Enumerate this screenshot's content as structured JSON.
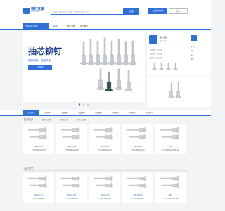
{
  "header": {
    "logo_title": "铆钉货源",
    "logo_sub": "liuhaib.com",
    "search_placeholder": "请输入要找的产品 例如：57铆钉 3.2*10 铝",
    "search_button": "搜索",
    "btn_primary": "免费发布供应",
    "btn_secondary": "登录"
  },
  "nav": {
    "all_categories": "全部商品分类 ▾",
    "items": [
      "首页",
      "快速下单",
      "关于我们"
    ]
  },
  "banner": {
    "headline": "抽芯铆钉",
    "subline": "国标规格，规格齐全",
    "button": "立即购买"
  },
  "shop_card": {
    "title": "铆钉货源",
    "tag": "生产厂家",
    "rows": [
      "营业执照：已认证",
      "实名认证：已认证",
      "企业认证：已认证"
    ]
  },
  "contact_card": {
    "rows": [
      "联 系 人：",
      "手机：",
      "电话：",
      "邮箱："
    ]
  },
  "category_tabs": [
    "开口铆钉",
    "封闭铆钉",
    "单鼓铆钉",
    "双鼓铆钉",
    "拉铆螺母",
    "环槽铆钉",
    "芯铆铆钉",
    "抽芯铆钉"
  ],
  "section1": {
    "title": "圆头开口型",
    "subtabs": [
      "圆头开口型",
      "大帽开口型",
      "沉头开口型"
    ],
    "products": [
      {
        "code": "GB12618.1",
        "name": "开口型平圆头抽芯铆钉"
      },
      {
        "code": "GB12618.2",
        "name": "开口型平圆头抽芯铆钉"
      },
      {
        "code": "GB12618.3",
        "name": "开口型平圆头抽芯铆钉"
      },
      {
        "code": "GB12618.4",
        "name": "开口型平圆头抽芯铆钉"
      },
      {
        "code": "BK1",
        "name": "开口型平圆头抽芯铆钉(铝)"
      }
    ]
  },
  "section2": {
    "title": "沉头开口型",
    "products": [
      {
        "code": "GB12617.1",
        "name": "开口型沉头抽芯铆钉"
      },
      {
        "code": "GB12617.2",
        "name": "开口型沉头抽芯铆钉"
      },
      {
        "code": "GB12617.3",
        "name": "开口型沉头抽芯铆钉"
      },
      {
        "code": "GB12617.4",
        "name": "开口型沉头抽芯铆钉"
      },
      {
        "code": "BK2",
        "name": "开口型沉头抽芯铆钉(铝)"
      }
    ]
  },
  "colors": {
    "accent": "#2f6fd8",
    "brand_dark": "#1b3f8f"
  }
}
